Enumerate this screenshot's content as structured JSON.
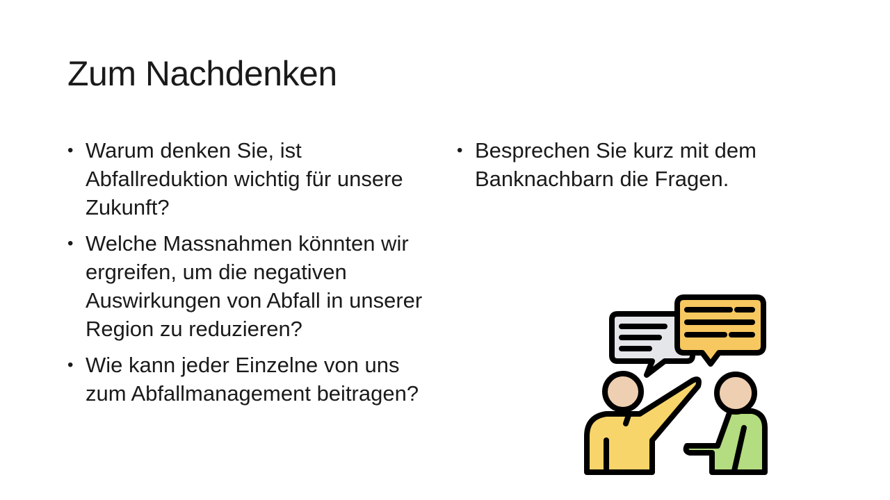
{
  "slide": {
    "title": "Zum Nachdenken",
    "left_bullets": [
      {
        "marker": "•",
        "text": "Warum denken Sie, ist Abfallreduktion wichtig für unsere Zukunft?"
      },
      {
        "marker": "•",
        "text": "Welche Massnahmen könnten wir ergreifen, um die negativen Auswirkungen von Abfall in unserer Region zu reduzieren?"
      },
      {
        "marker": "•",
        "text": "Wie kann jeder Einzelne von uns zum Abfallmanagement beitragen?"
      }
    ],
    "right_bullets": [
      {
        "marker": "•",
        "text": "Besprechen Sie kurz mit dem Banknachbarn die Fragen."
      }
    ],
    "illustration": {
      "icon": "discussion-icon",
      "colors": {
        "outline": "#000000",
        "bubble_left": "#e4e6ea",
        "bubble_right": "#f7c85f",
        "skin": "#efcfb1",
        "shirt_left": "#f7d56a",
        "shirt_right": "#b4dc80"
      }
    }
  }
}
